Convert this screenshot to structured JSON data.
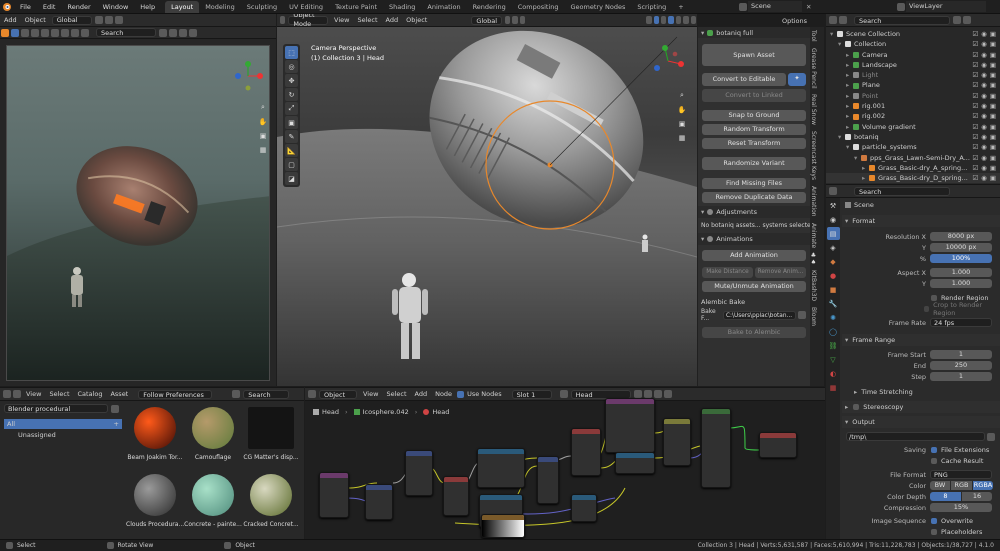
{
  "menubar": {
    "items": [
      "File",
      "Edit",
      "Render",
      "Window",
      "Help"
    ]
  },
  "workspaces": {
    "tabs": [
      "Layout",
      "Modeling",
      "Sculpting",
      "UV Editing",
      "Texture Paint",
      "Shading",
      "Animation",
      "Rendering",
      "Compositing",
      "Geometry Nodes",
      "Scripting"
    ],
    "plus": "+",
    "active": "Layout"
  },
  "scene": {
    "name": "Scene",
    "viewlayer": "ViewLayer"
  },
  "render_view": {
    "add": "Add",
    "object": "Object",
    "orientation": "Global",
    "search_placeholder": "Search"
  },
  "viewport": {
    "mode": "Object Mode",
    "menus": [
      "View",
      "Select",
      "Add",
      "Object"
    ],
    "orientation": "Global",
    "camera_title": "Camera Perspective",
    "collection_info": "(1) Collection 3 | Head",
    "options": "Options"
  },
  "npanel": {
    "title": "botaniq full",
    "buttons": {
      "spawn": "Spawn Asset",
      "convert_editable": "Convert to Editable",
      "convert_linked": "Convert to Linked",
      "snap": "Snap to Ground",
      "random_transform": "Random Transform",
      "reset_transform": "Reset Transform",
      "randomize_variant": "Randomize Variant",
      "find_missing": "Find Missing Files",
      "remove_duplicate": "Remove Duplicate Data"
    },
    "adjustments": "Adjustments",
    "adjust_msg": "No botaniq assets... systems selected!",
    "animations": "Animations",
    "add_animation": "Add Animation",
    "make_distance": "Make Distance",
    "remove_anim": "Remove Anim...",
    "mute": "Mute/Unmute Animation",
    "alembic": "Alembic Bake",
    "bake_label": "Bake F...",
    "bake_path": "C:\\Users\\pplac\\botan...",
    "bake_to": "Bake to Alembic",
    "tabs": [
      "Tool",
      "Grease Pencil",
      "Real Snow",
      "Screencast Keys",
      "Animation",
      "Animate",
      "KitBash3D",
      "Bloom"
    ]
  },
  "outliner": {
    "search_placeholder": "Search",
    "rows": [
      {
        "label": "Scene Collection",
        "depth": 0,
        "color": "#cfcfcf"
      },
      {
        "label": "Collection",
        "depth": 1,
        "color": "#cfcfcf"
      },
      {
        "label": "Camera",
        "depth": 2,
        "color": "#cfcfcf"
      },
      {
        "label": "Landscape",
        "depth": 2,
        "color": "#cfcfcf"
      },
      {
        "label": "Light",
        "depth": 2,
        "color": "#8a8a8a"
      },
      {
        "label": "Plane",
        "depth": 2,
        "color": "#cfcfcf"
      },
      {
        "label": "Point",
        "depth": 2,
        "color": "#8a8a8a"
      },
      {
        "label": "rig.001",
        "depth": 2,
        "color": "#cfcfcf"
      },
      {
        "label": "rig.002",
        "depth": 2,
        "color": "#cfcfcf"
      },
      {
        "label": "Volume gradient",
        "depth": 2,
        "color": "#cfcfcf"
      },
      {
        "label": "botaniq",
        "depth": 1,
        "color": "#cfcfcf"
      },
      {
        "label": "particle_systems",
        "depth": 2,
        "color": "#cfcfcf"
      },
      {
        "label": "pps_Grass_Lawn-Semi-Dry_A...",
        "depth": 3,
        "color": "#cfcfcf"
      },
      {
        "label": "Grass_Basic-dry_A_spring...",
        "depth": 4,
        "color": "#cfcfcf"
      },
      {
        "label": "Grass_Basic-dry_D_spring...",
        "depth": 4,
        "color": "#cfcfcf"
      }
    ]
  },
  "properties": {
    "search_placeholder": "Search",
    "context": "Scene",
    "format_title": "Format",
    "res_x_label": "Resolution X",
    "res_x": "8000 px",
    "res_y_label": "Y",
    "res_y": "10000 px",
    "pct_label": "%",
    "pct": "100%",
    "aspect_x_label": "Aspect X",
    "aspect_x": "1.000",
    "aspect_y_label": "Y",
    "aspect_y": "1.000",
    "render_region": "Render Region",
    "crop": "Crop to Render Region",
    "frame_rate_label": "Frame Rate",
    "frame_rate": "24 fps",
    "frame_range_title": "Frame Range",
    "frame_start_label": "Frame Start",
    "frame_start": "1",
    "end_label": "End",
    "end": "250",
    "step_label": "Step",
    "step": "1",
    "time_stretching": "Time Stretching",
    "stereoscopy": "Stereoscopy",
    "output_title": "Output",
    "output_path": "/tmp\\",
    "saving_label": "Saving",
    "file_ext": "File Extensions",
    "cache_result": "Cache Result",
    "file_format_label": "File Format",
    "file_format": "PNG",
    "color_label": "Color",
    "color_opts": [
      "BW",
      "RGB",
      "RGBA"
    ],
    "color_active": "RGBA",
    "depth_label": "Color Depth",
    "depth_opts": [
      "8",
      "16"
    ],
    "compression_label": "Compression",
    "compression": "15%",
    "seq_label": "Image Sequence",
    "overwrite": "Overwrite",
    "placeholders": "Placeholders"
  },
  "asset_browser": {
    "menus": [
      "View",
      "Select",
      "Catalog",
      "Asset"
    ],
    "follow": "Follow Preferences",
    "search_placeholder": "Search",
    "library": "Blender procedural",
    "catalog_all": "All",
    "catalog_unassigned": "Unassigned",
    "assets": [
      {
        "label": "Beam Joakim Tor...",
        "c1": "#ff5a1a",
        "c2": "#3a0a05"
      },
      {
        "label": "Camouflage",
        "c1": "#b59a6a",
        "c2": "#5d7a3a"
      },
      {
        "label": "CG Matter's disp...",
        "c1": "#141414",
        "c2": "#0a0a0a"
      },
      {
        "label": "Clouds Procedura...",
        "c1": "#9a9a9a",
        "c2": "#2a2a2a"
      },
      {
        "label": "Concrete - painte...",
        "c1": "#a8e0c8",
        "c2": "#4d8a7a"
      },
      {
        "label": "Cracked Concret...",
        "c1": "#d8d8c0",
        "c2": "#5a6a2a"
      }
    ]
  },
  "node_editor": {
    "object": "Object",
    "menus": [
      "View",
      "Select",
      "Add",
      "Node"
    ],
    "use_nodes": "Use Nodes",
    "slot": "Slot 1",
    "material": "Head",
    "breadcrumb": [
      "Head",
      "Icosphere.042",
      "Head"
    ]
  },
  "statusbar": {
    "select": "Select",
    "rotate": "Rotate View",
    "object": "Object",
    "stats": "Collection 3 | Head | Verts:5,631,587 | Faces:5,610,994 | Tris:11,228,783 | Objects:1/38,727 | 4.1.0"
  },
  "colors": {
    "accent": "#4772b3",
    "orange": "#e8882b"
  }
}
